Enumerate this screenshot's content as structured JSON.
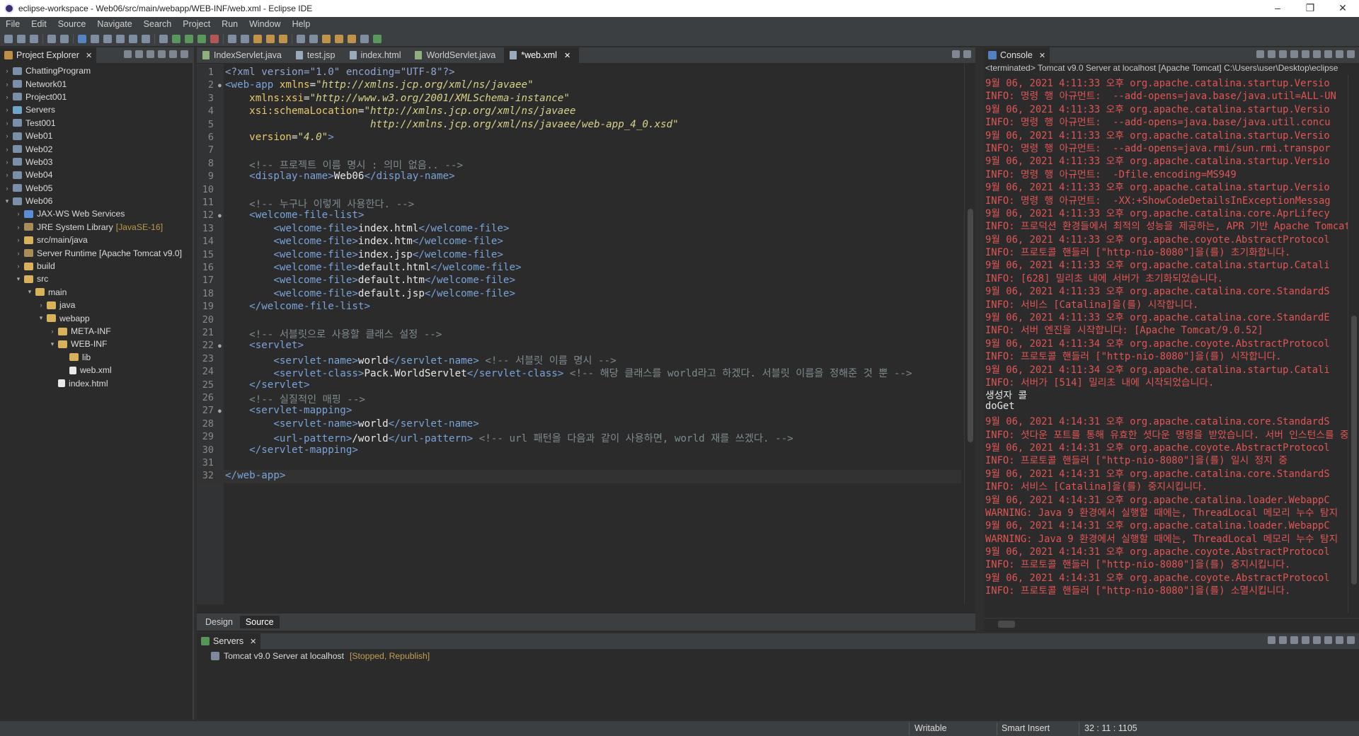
{
  "window": {
    "title": "eclipse-workspace - Web06/src/main/webapp/WEB-INF/web.xml - Eclipse IDE"
  },
  "menu": [
    "File",
    "Edit",
    "Source",
    "Navigate",
    "Search",
    "Project",
    "Run",
    "Window",
    "Help"
  ],
  "explorer": {
    "tab_label": "Project Explorer",
    "items": [
      {
        "label": "ChattingProgram",
        "depth": 0,
        "tw": ">",
        "icon": "project-icon"
      },
      {
        "label": "Network01",
        "depth": 0,
        "tw": ">",
        "icon": "project-icon"
      },
      {
        "label": "Project001",
        "depth": 0,
        "tw": ">",
        "icon": "project-icon"
      },
      {
        "label": "Servers",
        "depth": 0,
        "tw": ">",
        "icon": "server-folder-icon"
      },
      {
        "label": "Test001",
        "depth": 0,
        "tw": ">",
        "icon": "project-icon"
      },
      {
        "label": "Web01",
        "depth": 0,
        "tw": ">",
        "icon": "project-icon"
      },
      {
        "label": "Web02",
        "depth": 0,
        "tw": ">",
        "icon": "project-icon"
      },
      {
        "label": "Web03",
        "depth": 0,
        "tw": ">",
        "icon": "project-icon"
      },
      {
        "label": "Web04",
        "depth": 0,
        "tw": ">",
        "icon": "project-icon"
      },
      {
        "label": "Web05",
        "depth": 0,
        "tw": ">",
        "icon": "project-icon"
      },
      {
        "label": "Web06",
        "depth": 0,
        "tw": "v",
        "icon": "project-icon"
      },
      {
        "label": "JAX-WS Web Services",
        "depth": 1,
        "tw": ">",
        "icon": "webservice-icon"
      },
      {
        "label": "JRE System Library",
        "decor": "[JavaSE-16]",
        "depth": 1,
        "tw": ">",
        "icon": "library-icon"
      },
      {
        "label": "src/main/java",
        "depth": 1,
        "tw": ">",
        "icon": "source-folder-icon"
      },
      {
        "label": "Server Runtime [Apache Tomcat v9.0]",
        "depth": 1,
        "tw": ">",
        "icon": "library-icon"
      },
      {
        "label": "build",
        "depth": 1,
        "tw": ">",
        "icon": "folder-icon"
      },
      {
        "label": "src",
        "depth": 1,
        "tw": "v",
        "icon": "folder-icon"
      },
      {
        "label": "main",
        "depth": 2,
        "tw": "v",
        "icon": "folder-icon"
      },
      {
        "label": "java",
        "depth": 3,
        "tw": ">",
        "icon": "folder-icon"
      },
      {
        "label": "webapp",
        "depth": 3,
        "tw": "v",
        "icon": "folder-icon"
      },
      {
        "label": "META-INF",
        "depth": 4,
        "tw": ">",
        "icon": "folder-icon"
      },
      {
        "label": "WEB-INF",
        "depth": 4,
        "tw": "v",
        "icon": "folder-icon"
      },
      {
        "label": "lib",
        "depth": 5,
        "tw": "",
        "icon": "folder-icon"
      },
      {
        "label": "web.xml",
        "depth": 5,
        "tw": "",
        "icon": "file-icon"
      },
      {
        "label": "index.html",
        "depth": 4,
        "tw": "",
        "icon": "file-icon"
      }
    ]
  },
  "editor": {
    "tabs": [
      {
        "label": "IndexServlet.java",
        "icon": "java-file-icon",
        "active": false
      },
      {
        "label": "test.jsp",
        "icon": "jsp-file-icon",
        "active": false
      },
      {
        "label": "index.html",
        "icon": "html-file-icon",
        "active": false
      },
      {
        "label": "WorldServlet.java",
        "icon": "java-file-icon",
        "active": false
      },
      {
        "label": "*web.xml",
        "icon": "xml-file-icon",
        "active": true
      }
    ],
    "lines": [
      {
        "n": "1",
        "fold": "",
        "parts": [
          [
            "pi",
            "<?xml version=\"1.0\" encoding=\"UTF-8\"?>"
          ]
        ]
      },
      {
        "n": "2",
        "fold": "●",
        "parts": [
          [
            "tag",
            "<web-app "
          ],
          [
            "attr",
            "xmlns"
          ],
          [
            "txt",
            "="
          ],
          [
            "val",
            "\"http://xmlns.jcp.org/xml/ns/javaee\""
          ]
        ]
      },
      {
        "n": "3",
        "fold": "",
        "parts": [
          [
            "attr",
            "    xmlns:xsi"
          ],
          [
            "txt",
            "="
          ],
          [
            "val",
            "\"http://www.w3.org/2001/XMLSchema-instance\""
          ]
        ]
      },
      {
        "n": "4",
        "fold": "",
        "parts": [
          [
            "attr",
            "    xsi:schemaLocation"
          ],
          [
            "txt",
            "="
          ],
          [
            "val",
            "\"http://xmlns.jcp.org/xml/ns/javaee"
          ]
        ]
      },
      {
        "n": "5",
        "fold": "",
        "parts": [
          [
            "val",
            "                        http://xmlns.jcp.org/xml/ns/javaee/web-app_4_0.xsd\""
          ]
        ]
      },
      {
        "n": "6",
        "fold": "",
        "parts": [
          [
            "attr",
            "    version"
          ],
          [
            "txt",
            "="
          ],
          [
            "val",
            "\"4.0\""
          ],
          [
            "tag",
            ">"
          ]
        ]
      },
      {
        "n": "7",
        "fold": "",
        "parts": []
      },
      {
        "n": "8",
        "fold": "",
        "parts": [
          [
            "com",
            "    <!-- 프로젝트 이름 명시 : 의미 없음.. -->"
          ]
        ]
      },
      {
        "n": "9",
        "fold": "",
        "parts": [
          [
            "tag",
            "    <display-name>"
          ],
          [
            "txt",
            "Web06"
          ],
          [
            "tag",
            "</display-name>"
          ]
        ]
      },
      {
        "n": "10",
        "fold": "",
        "parts": []
      },
      {
        "n": "11",
        "fold": "",
        "parts": [
          [
            "com",
            "    <!-- 누구나 이렇게 사용한다. -->"
          ]
        ]
      },
      {
        "n": "12",
        "fold": "●",
        "parts": [
          [
            "tag",
            "    <welcome-file-list>"
          ]
        ]
      },
      {
        "n": "13",
        "fold": "",
        "parts": [
          [
            "tag",
            "        <welcome-file>"
          ],
          [
            "txt",
            "index.html"
          ],
          [
            "tag",
            "</welcome-file>"
          ]
        ]
      },
      {
        "n": "14",
        "fold": "",
        "parts": [
          [
            "tag",
            "        <welcome-file>"
          ],
          [
            "txt",
            "index.htm"
          ],
          [
            "tag",
            "</welcome-file>"
          ]
        ]
      },
      {
        "n": "15",
        "fold": "",
        "parts": [
          [
            "tag",
            "        <welcome-file>"
          ],
          [
            "txt",
            "index.jsp"
          ],
          [
            "tag",
            "</welcome-file>"
          ]
        ]
      },
      {
        "n": "16",
        "fold": "",
        "parts": [
          [
            "tag",
            "        <welcome-file>"
          ],
          [
            "txt",
            "default.html"
          ],
          [
            "tag",
            "</welcome-file>"
          ]
        ]
      },
      {
        "n": "17",
        "fold": "",
        "parts": [
          [
            "tag",
            "        <welcome-file>"
          ],
          [
            "txt",
            "default.htm"
          ],
          [
            "tag",
            "</welcome-file>"
          ]
        ]
      },
      {
        "n": "18",
        "fold": "",
        "parts": [
          [
            "tag",
            "        <welcome-file>"
          ],
          [
            "txt",
            "default.jsp"
          ],
          [
            "tag",
            "</welcome-file>"
          ]
        ]
      },
      {
        "n": "19",
        "fold": "",
        "parts": [
          [
            "tag",
            "    </welcome-file-list>"
          ]
        ]
      },
      {
        "n": "20",
        "fold": "",
        "parts": []
      },
      {
        "n": "21",
        "fold": "",
        "parts": [
          [
            "com",
            "    <!-- 서블릿으로 사용할 클래스 설정 -->"
          ]
        ]
      },
      {
        "n": "22",
        "fold": "●",
        "parts": [
          [
            "tag",
            "    <servlet>"
          ]
        ]
      },
      {
        "n": "23",
        "fold": "",
        "parts": [
          [
            "tag",
            "        <servlet-name>"
          ],
          [
            "txt",
            "world"
          ],
          [
            "tag",
            "</servlet-name> "
          ],
          [
            "com",
            "<!-- 서블릿 이름 명시 -->"
          ]
        ]
      },
      {
        "n": "24",
        "fold": "",
        "parts": [
          [
            "tag",
            "        <servlet-class>"
          ],
          [
            "txt",
            "Pack.WorldServlet"
          ],
          [
            "tag",
            "</servlet-class> "
          ],
          [
            "com",
            "<!-- 해당 클래스를 world라고 하겠다. 서블릿 이름을 정해준 것 뿐 -->"
          ]
        ]
      },
      {
        "n": "25",
        "fold": "",
        "parts": [
          [
            "tag",
            "    </servlet>"
          ]
        ]
      },
      {
        "n": "26",
        "fold": "",
        "parts": [
          [
            "com",
            "    <!-- 실질적인 매핑 -->"
          ]
        ]
      },
      {
        "n": "27",
        "fold": "●",
        "parts": [
          [
            "tag",
            "    <servlet-mapping>"
          ]
        ]
      },
      {
        "n": "28",
        "fold": "",
        "parts": [
          [
            "tag",
            "        <servlet-name>"
          ],
          [
            "txt",
            "world"
          ],
          [
            "tag",
            "</servlet-name>"
          ]
        ]
      },
      {
        "n": "29",
        "fold": "",
        "parts": [
          [
            "tag",
            "        <url-pattern>"
          ],
          [
            "txt",
            "/world"
          ],
          [
            "tag",
            "</url-pattern> "
          ],
          [
            "com",
            "<!-- url 패턴을 다음과 같이 사용하면, world 재를 쓰겠다. -->"
          ]
        ]
      },
      {
        "n": "30",
        "fold": "",
        "parts": [
          [
            "tag",
            "    </servlet-mapping>"
          ]
        ]
      },
      {
        "n": "31",
        "fold": "",
        "parts": []
      },
      {
        "n": "32",
        "fold": "",
        "parts": [
          [
            "tag",
            "</web-app>"
          ]
        ],
        "current": true
      }
    ],
    "bottom_tabs": [
      "Design",
      "Source"
    ]
  },
  "console": {
    "tab_label": "Console",
    "header": "<terminated> Tomcat v9.0 Server at localhost [Apache Tomcat] C:\\Users\\user\\Desktop\\eclipse",
    "lines": [
      {
        "t": "9월 06, 2021 4:11:33 오후 org.apache.catalina.startup.Versio",
        "w": false
      },
      {
        "t": "INFO: 명령 행 아규먼트:  --add-opens=java.base/java.util=ALL-UN",
        "w": false
      },
      {
        "t": "9월 06, 2021 4:11:33 오후 org.apache.catalina.startup.Versio",
        "w": false
      },
      {
        "t": "INFO: 명령 행 아규먼트:  --add-opens=java.base/java.util.concu",
        "w": false
      },
      {
        "t": "9월 06, 2021 4:11:33 오후 org.apache.catalina.startup.Versio",
        "w": false
      },
      {
        "t": "INFO: 명령 행 아규먼트:  --add-opens=java.rmi/sun.rmi.transpor",
        "w": false
      },
      {
        "t": "9월 06, 2021 4:11:33 오후 org.apache.catalina.startup.Versio",
        "w": false
      },
      {
        "t": "INFO: 명령 행 아규먼트:  -Dfile.encoding=MS949",
        "w": false
      },
      {
        "t": "9월 06, 2021 4:11:33 오후 org.apache.catalina.startup.Versio",
        "w": false
      },
      {
        "t": "INFO: 명령 행 아규먼트:  -XX:+ShowCodeDetailsInExceptionMessag",
        "w": false
      },
      {
        "t": "9월 06, 2021 4:11:33 오후 org.apache.catalina.core.AprLifecy",
        "w": false
      },
      {
        "t": "INFO: 프로덕션 환경들에서 최적의 성능을 제공하는, APR 기반 Apache Tomcat",
        "w": false
      },
      {
        "t": "9월 06, 2021 4:11:33 오후 org.apache.coyote.AbstractProtocol",
        "w": false
      },
      {
        "t": "INFO: 프로토콜 핸들러 [\"http-nio-8080\"]을(를) 초기화합니다.",
        "w": false
      },
      {
        "t": "9월 06, 2021 4:11:33 오후 org.apache.catalina.startup.Catali",
        "w": false
      },
      {
        "t": "INFO: [628] 밀리초 내에 서버가 초기화되었습니다.",
        "w": false
      },
      {
        "t": "9월 06, 2021 4:11:33 오후 org.apache.catalina.core.StandardS",
        "w": false
      },
      {
        "t": "INFO: 서비스 [Catalina]을(를) 시작합니다.",
        "w": false
      },
      {
        "t": "9월 06, 2021 4:11:33 오후 org.apache.catalina.core.StandardE",
        "w": false
      },
      {
        "t": "INFO: 서버 엔진을 시작합니다: [Apache Tomcat/9.0.52]",
        "w": false
      },
      {
        "t": "9월 06, 2021 4:11:34 오후 org.apache.coyote.AbstractProtocol",
        "w": false
      },
      {
        "t": "INFO: 프로토콜 핸들러 [\"http-nio-8080\"]을(를) 시작합니다.",
        "w": false
      },
      {
        "t": "9월 06, 2021 4:11:34 오후 org.apache.catalina.startup.Catali",
        "w": false
      },
      {
        "t": "INFO: 서버가 [514] 밀리초 내에 시작되었습니다.",
        "w": false
      },
      {
        "t": "생성자 콜",
        "w": true
      },
      {
        "t": "doGet",
        "w": true
      },
      {
        "t": "9월 06, 2021 4:14:31 오후 org.apache.catalina.core.StandardS",
        "w": false
      },
      {
        "t": "INFO: 셧다운 포트를 통해 유효한 셧다운 명령을 받았습니다. 서버 인스턴스를 중지",
        "w": false
      },
      {
        "t": "9월 06, 2021 4:14:31 오후 org.apache.coyote.AbstractProtocol",
        "w": false
      },
      {
        "t": "INFO: 프로토콜 핸들러 [\"http-nio-8080\"]을(를) 일시 정지 중",
        "w": false
      },
      {
        "t": "9월 06, 2021 4:14:31 오후 org.apache.catalina.core.StandardS",
        "w": false
      },
      {
        "t": "INFO: 서비스 [Catalina]을(를) 중지시킵니다.",
        "w": false
      },
      {
        "t": "9월 06, 2021 4:14:31 오후 org.apache.catalina.loader.WebappC",
        "w": false
      },
      {
        "t": "WARNING: Java 9 환경에서 실행할 때에는, ThreadLocal 메모리 누수 탐지",
        "w": false
      },
      {
        "t": "9월 06, 2021 4:14:31 오후 org.apache.catalina.loader.WebappC",
        "w": false
      },
      {
        "t": "WARNING: Java 9 환경에서 실행할 때에는, ThreadLocal 메모리 누수 탐지",
        "w": false
      },
      {
        "t": "9월 06, 2021 4:14:31 오후 org.apache.coyote.AbstractProtocol",
        "w": false
      },
      {
        "t": "INFO: 프로토콜 핸들러 [\"http-nio-8080\"]을(를) 중지시킵니다.",
        "w": false
      },
      {
        "t": "9월 06, 2021 4:14:31 오후 org.apache.coyote.AbstractProtocol",
        "w": false
      },
      {
        "t": "INFO: 프로토콜 핸들러 [\"http-nio-8080\"]을(를) 소멸시킵니다.",
        "w": false
      }
    ]
  },
  "servers": {
    "tab_label": "Servers",
    "server_name": "Tomcat v9.0 Server at localhost",
    "server_state": "[Stopped, Republish]"
  },
  "status": {
    "writable": "Writable",
    "insert_mode": "Smart Insert",
    "position": "32 : 11 : 1105"
  }
}
